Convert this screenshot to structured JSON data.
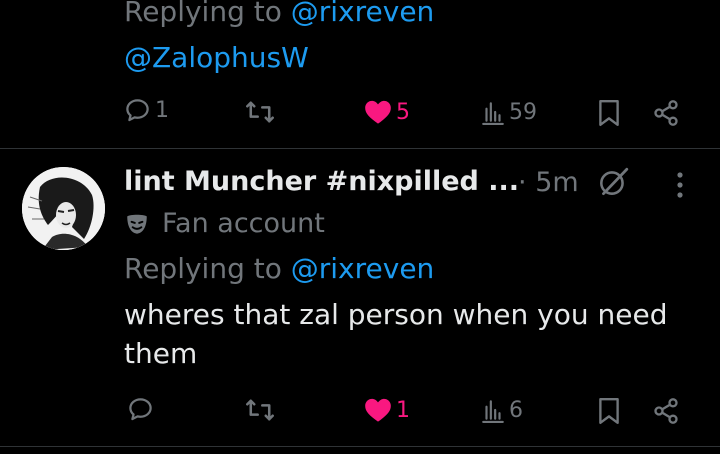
{
  "post1": {
    "replying_prefix": "Replying to",
    "replying_handle": "@rixreven",
    "mention": "@ZalophusW",
    "actions": {
      "replies": "1",
      "likes": "5",
      "views": "59"
    },
    "like_color": "#f91880"
  },
  "post2": {
    "display_name": "lint Muncher #nixpilled ...",
    "separator": "·",
    "time": "5m",
    "badge_label": "Fan account",
    "replying_prefix": "Replying to",
    "replying_handle": "@rixreven",
    "body_line1": "wheres that zal person when you need",
    "body_line2": "them",
    "actions": {
      "replies": "",
      "likes": "1",
      "views": "6"
    }
  },
  "icons": [
    "reply-icon",
    "retweet-icon",
    "like-icon",
    "views-icon",
    "bookmark-icon",
    "share-icon",
    "more-icon",
    "grok-icon",
    "fan-badge-icon"
  ],
  "colors": {
    "background": "#000000",
    "text": "#e7e9ea",
    "muted": "#71767b",
    "link": "#1d9bf0",
    "like": "#f91880"
  }
}
